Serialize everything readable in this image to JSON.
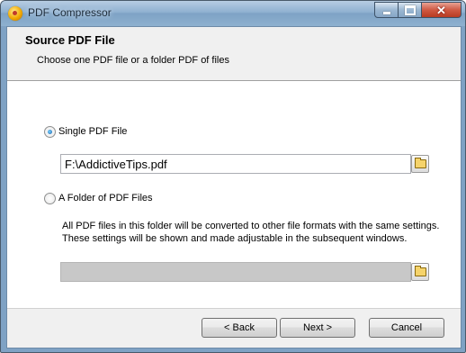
{
  "window": {
    "title": "PDF Compressor"
  },
  "header": {
    "title": "Source PDF File",
    "subtitle": "Choose one PDF file or a folder PDF of files"
  },
  "options": {
    "single": {
      "label": "Single PDF File",
      "checked": true,
      "path": "F:\\AddictiveTips.pdf"
    },
    "folder": {
      "label": "A Folder of PDF Files",
      "checked": false,
      "description": "All PDF files in this folder will be converted to other file formats with the same settings. These settings will be shown and made adjustable in the subsequent windows.",
      "path": ""
    }
  },
  "buttons": {
    "back": "< Back",
    "next": "Next >",
    "cancel": "Cancel"
  },
  "icons": {
    "app": "pdf-compressor-app-icon",
    "minimize": "minimize-icon",
    "maximize": "maximize-icon",
    "close": "close-icon",
    "browse": "open-folder-icon"
  }
}
